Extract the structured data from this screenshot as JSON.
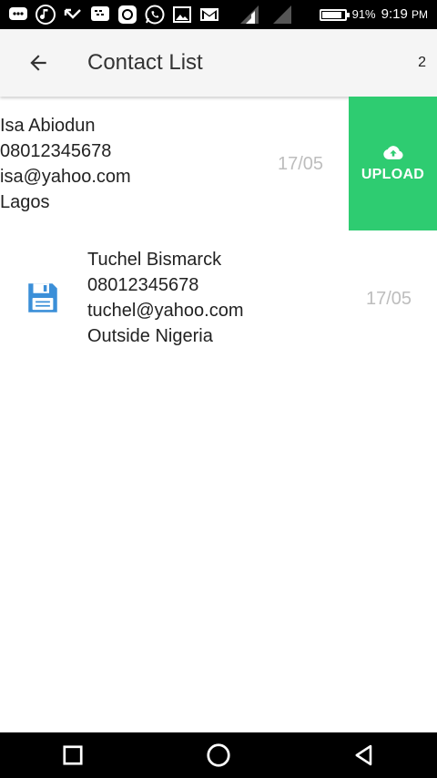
{
  "status_bar": {
    "icons": [
      "messages-icon",
      "music-icon",
      "missed-call-icon",
      "bbm-icon",
      "instagram-icon",
      "whatsapp-icon",
      "gallery-icon",
      "gmail-icon",
      "signal-1-icon",
      "signal-2-icon"
    ],
    "battery_text": "91%",
    "battery_level": 0.91,
    "time": "9:19",
    "ampm": "PM"
  },
  "app_bar": {
    "back_icon": "arrow-left-icon",
    "title": "Contact List",
    "count": "2"
  },
  "contacts": [
    {
      "name": "Isa Abiodun",
      "phone": "08012345678",
      "email": "isa@yahoo.com",
      "location": "Lagos",
      "date": "17/05",
      "action": {
        "icon": "cloud-upload-icon",
        "label": "UPLOAD",
        "color": "#2ecc71"
      }
    },
    {
      "name": "Tuchel Bismarck",
      "phone": "08012345678",
      "email": "tuchel@yahoo.com",
      "location": "Outside Nigeria",
      "date": "17/05",
      "icon": "floppy-disk-icon",
      "icon_color": "#3b8fd8"
    }
  ],
  "nav_bar": {
    "icons": [
      "recents-icon",
      "home-icon",
      "back-icon"
    ]
  },
  "colors": {
    "status_bar": "#000000",
    "app_bar": "#f5f5f5",
    "accent_green": "#2ecc71",
    "date_gray": "#bdbdbd"
  }
}
